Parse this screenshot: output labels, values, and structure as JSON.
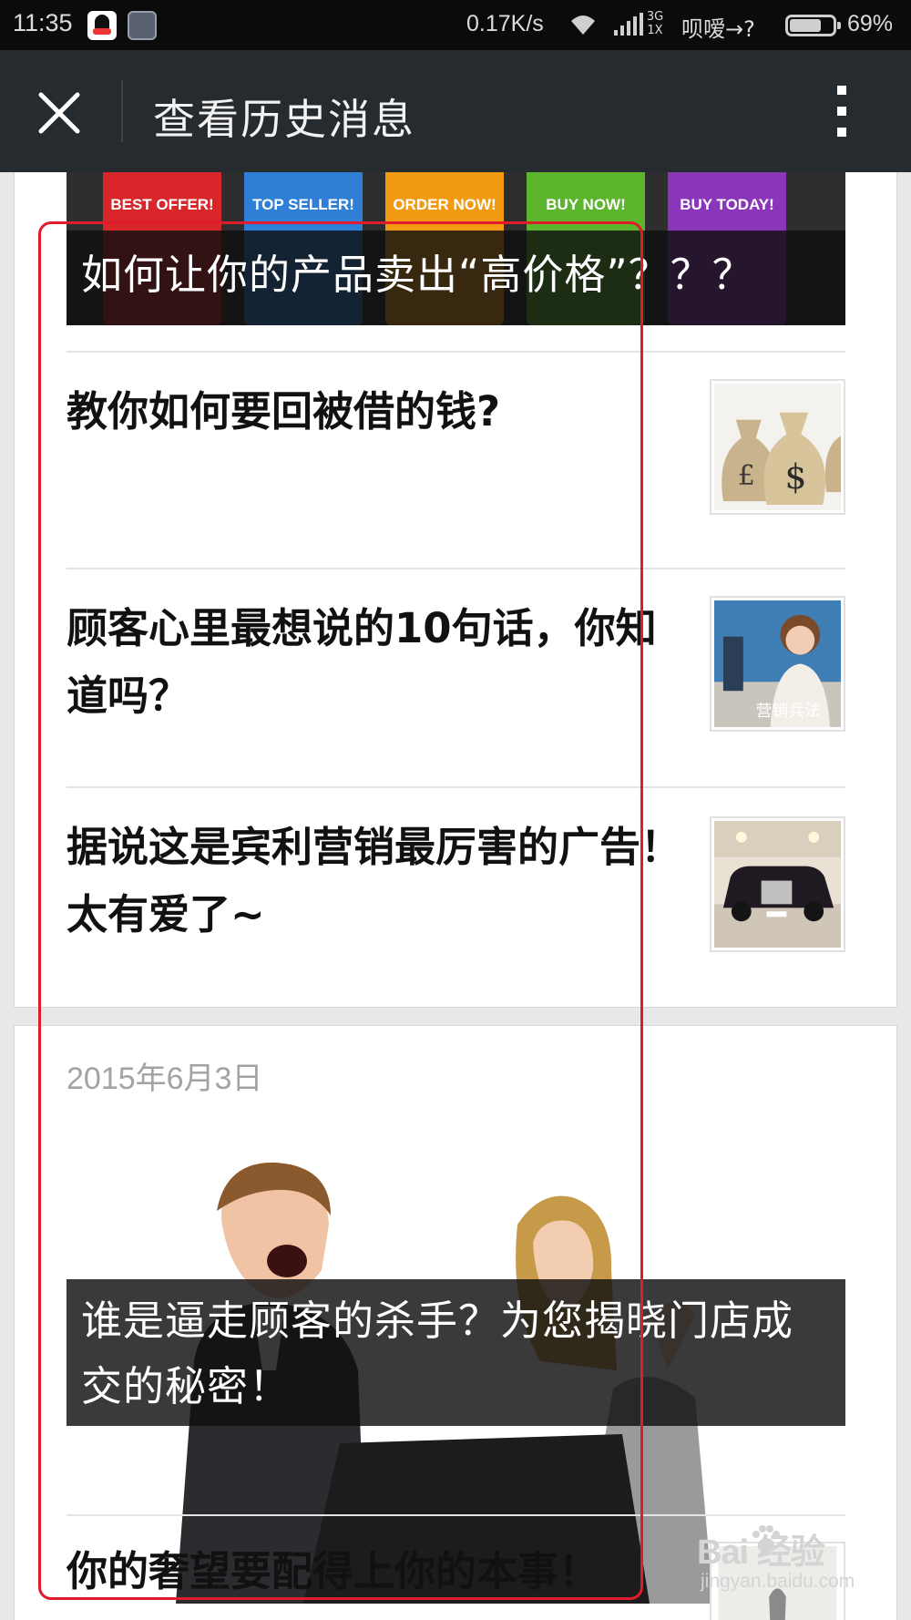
{
  "status_bar": {
    "time": "11:35",
    "net_speed": "0.17K/s",
    "net_type": "3G",
    "net_sub": "1X",
    "carrier": "呗嗳→?",
    "battery": "69%",
    "battery_level": 0.69
  },
  "header": {
    "title": "查看历史消息",
    "close_icon": "close-icon",
    "more_icon": "more-vertical-icon"
  },
  "cards": [
    {
      "cover": {
        "caption": "如何让你的产品卖出“高价格”？？？",
        "price_tags": [
          "BEST OFFER!",
          "TOP SELLER!",
          "ORDER NOW!",
          "BUY NOW!",
          "BUY TODAY!"
        ],
        "tag_colors": [
          "#d8262b",
          "#2f7fd6",
          "#f29a11",
          "#5cb52d",
          "#8a36b8"
        ]
      },
      "items": [
        {
          "title": "教你如何要回被借的钱?"
        },
        {
          "title": "顾客心里最想说的10句话，你知道吗？",
          "thumb_text": "营销兵法"
        },
        {
          "title": "据说这是宾利营销最厉害的广告！太有爱了~"
        }
      ]
    },
    {
      "date": "2015年6月3日",
      "cover": {
        "caption": "谁是逼走顾客的杀手？为您揭晓门店成交的秘密！"
      },
      "items": [
        {
          "title": "你的奢望要配得上你的本事！"
        }
      ]
    }
  ],
  "watermark": {
    "brand": "Bai  经验",
    "url": "jingyan.baidu.com"
  },
  "colors": {
    "highlight_frame": "#e01b2a",
    "header_bg": "#262b2f"
  }
}
